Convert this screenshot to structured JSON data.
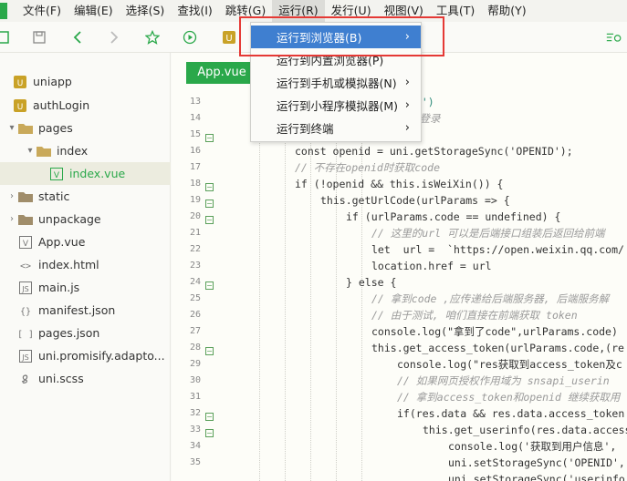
{
  "menubar": {
    "items": [
      "文件(F)",
      "编辑(E)",
      "选择(S)",
      "查找(I)",
      "跳转(G)",
      "运行(R)",
      "发行(U)",
      "视图(V)",
      "工具(T)",
      "帮助(Y)"
    ]
  },
  "run_menu": {
    "items": [
      {
        "label": "运行到浏览器(B)",
        "submenu": true
      },
      {
        "label": "运行到内置浏览器(P)",
        "submenu": false
      },
      {
        "label": "运行到手机或模拟器(N)",
        "submenu": true
      },
      {
        "label": "运行到小程序模拟器(M)",
        "submenu": true
      },
      {
        "label": "运行到终端",
        "submenu": true
      }
    ]
  },
  "sidebar": {
    "items": [
      {
        "label": "uniapp",
        "icon": "project-icon"
      },
      {
        "label": "authLogin",
        "icon": "project-icon"
      },
      {
        "label": "pages",
        "icon": "folder-icon"
      },
      {
        "label": "index",
        "icon": "folder-icon"
      },
      {
        "label": "index.vue",
        "icon": "vue-file-icon"
      },
      {
        "label": "static",
        "icon": "folder-icon"
      },
      {
        "label": "unpackage",
        "icon": "folder-icon"
      },
      {
        "label": "App.vue",
        "icon": "vue-file-icon"
      },
      {
        "label": "index.html",
        "icon": "html-file-icon"
      },
      {
        "label": "main.js",
        "icon": "js-file-icon"
      },
      {
        "label": "manifest.json",
        "icon": "json-file-icon"
      },
      {
        "label": "pages.json",
        "icon": "json-file-icon"
      },
      {
        "label": "uni.promisify.adapto...",
        "icon": "js-file-icon"
      },
      {
        "label": "uni.scss",
        "icon": "scss-file-icon"
      }
    ]
  },
  "editor": {
    "tab_label": "App.vue",
    "line_numbers": [
      "13",
      "14",
      "15",
      "16",
      "17",
      "18",
      "19",
      "20",
      "21",
      "22",
      "23",
      "24",
      "25",
      "26",
      "27",
      "28",
      "29",
      "30",
      "31",
      "32",
      "33",
      "34",
      "35"
    ],
    "code_lines": [
      "ow')",
      "动登录",
      "",
      "const openid = uni.getStorageSync('OPENID');",
      "// 不存在openid时获取code",
      "if (!openid && this.isWeiXin()) {",
      "this.getUrlCode(urlParams => {",
      "if (urlParams.code == undefined) {",
      "// 这里的url 可以是后端接口组装后返回给前端",
      "let  url =  `https://open.weixin.qq.com/",
      "location.href = url",
      "} else {",
      "// 拿到code ,应传递给后端服务器, 后端服务解",
      "// 由于测试, 咱们直接在前端获取 token",
      "console.log(\"拿到了code\",urlParams.code)",
      "this.get_access_token(urlParams.code,(re",
      "console.log(\"res获取到access_token及c",
      "// 如果网页授权作用域为 snsapi_userin",
      "// 拿到access_token和openid 继续获取用",
      "if(res.data && res.data.access_token",
      "this.get_userinfo(res.data.access",
      "console.log('获取到用户信息',",
      "uni.setStorageSync('OPENID',",
      "uni.setStorageSync('userinfo"
    ]
  },
  "colors": {
    "accent_green": "#2aa84a",
    "menu_highlight": "#3f7fd0",
    "annotation_red": "#e53935"
  }
}
